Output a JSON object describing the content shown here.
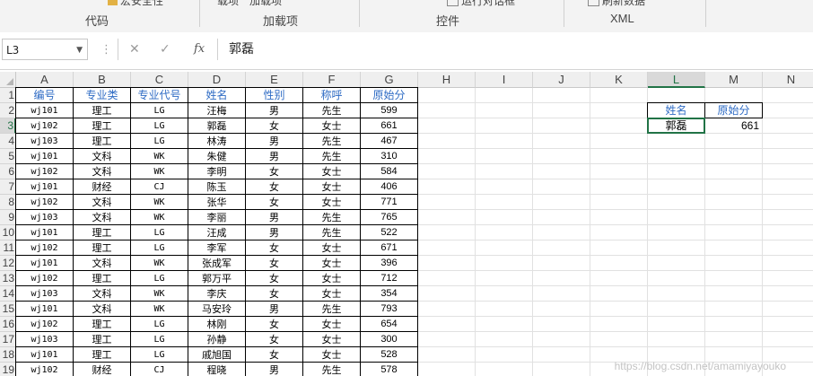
{
  "ribbon": {
    "top_cut_left": "宏安全性",
    "top_cut_mid1": "载项",
    "top_cut_mid2": "加载项",
    "top_cut_right1": "运行对话框",
    "top_cut_right2": "刷新数据",
    "groups": {
      "code": "代码",
      "addins": "加载项",
      "controls": "控件",
      "xml": "XML"
    }
  },
  "formula_bar": {
    "name_box": "L3",
    "cancel_symbol": "✕",
    "enter_symbol": "✓",
    "fx_label": "fx",
    "content": "郭磊"
  },
  "sheet": {
    "columns": [
      "A",
      "B",
      "C",
      "D",
      "E",
      "F",
      "G",
      "H",
      "I",
      "J",
      "K",
      "L",
      "M",
      "N"
    ],
    "rows": [
      "1",
      "2",
      "3",
      "4",
      "5",
      "6",
      "7",
      "8",
      "9",
      "10",
      "11",
      "12",
      "13",
      "14",
      "15",
      "16",
      "17",
      "18",
      "19"
    ],
    "selected_column": "L",
    "selected_row": "3",
    "table_headers": [
      "编号",
      "专业类",
      "专业代号",
      "姓名",
      "性别",
      "称呼",
      "原始分"
    ],
    "table_rows": [
      [
        "wj101",
        "理工",
        "LG",
        "汪梅",
        "男",
        "先生",
        "599"
      ],
      [
        "wj102",
        "理工",
        "LG",
        "郭磊",
        "女",
        "女士",
        "661"
      ],
      [
        "wj103",
        "理工",
        "LG",
        "林涛",
        "男",
        "先生",
        "467"
      ],
      [
        "wj101",
        "文科",
        "WK",
        "朱健",
        "男",
        "先生",
        "310"
      ],
      [
        "wj102",
        "文科",
        "WK",
        "李明",
        "女",
        "女士",
        "584"
      ],
      [
        "wj101",
        "财经",
        "CJ",
        "陈玉",
        "女",
        "女士",
        "406"
      ],
      [
        "wj102",
        "文科",
        "WK",
        "张华",
        "女",
        "女士",
        "771"
      ],
      [
        "wj103",
        "文科",
        "WK",
        "李丽",
        "男",
        "先生",
        "765"
      ],
      [
        "wj101",
        "理工",
        "LG",
        "汪成",
        "男",
        "先生",
        "522"
      ],
      [
        "wj102",
        "理工",
        "LG",
        "李军",
        "女",
        "女士",
        "671"
      ],
      [
        "wj101",
        "文科",
        "WK",
        "张成军",
        "女",
        "女士",
        "396"
      ],
      [
        "wj102",
        "理工",
        "LG",
        "郭万平",
        "女",
        "女士",
        "712"
      ],
      [
        "wj103",
        "文科",
        "WK",
        "李庆",
        "女",
        "女士",
        "354"
      ],
      [
        "wj101",
        "文科",
        "WK",
        "马安玲",
        "男",
        "先生",
        "793"
      ],
      [
        "wj102",
        "理工",
        "LG",
        "林刚",
        "女",
        "女士",
        "654"
      ],
      [
        "wj103",
        "理工",
        "LG",
        "孙静",
        "女",
        "女士",
        "300"
      ],
      [
        "wj101",
        "理工",
        "LG",
        "戚旭国",
        "女",
        "女士",
        "528"
      ],
      [
        "wj102",
        "财经",
        "CJ",
        "程晓",
        "男",
        "先生",
        "578"
      ]
    ],
    "lookup": {
      "header_name": "姓名",
      "header_score": "原始分",
      "name": "郭磊",
      "score": "661"
    }
  },
  "watermark": "https://blog.csdn.net/amamiyayouko"
}
